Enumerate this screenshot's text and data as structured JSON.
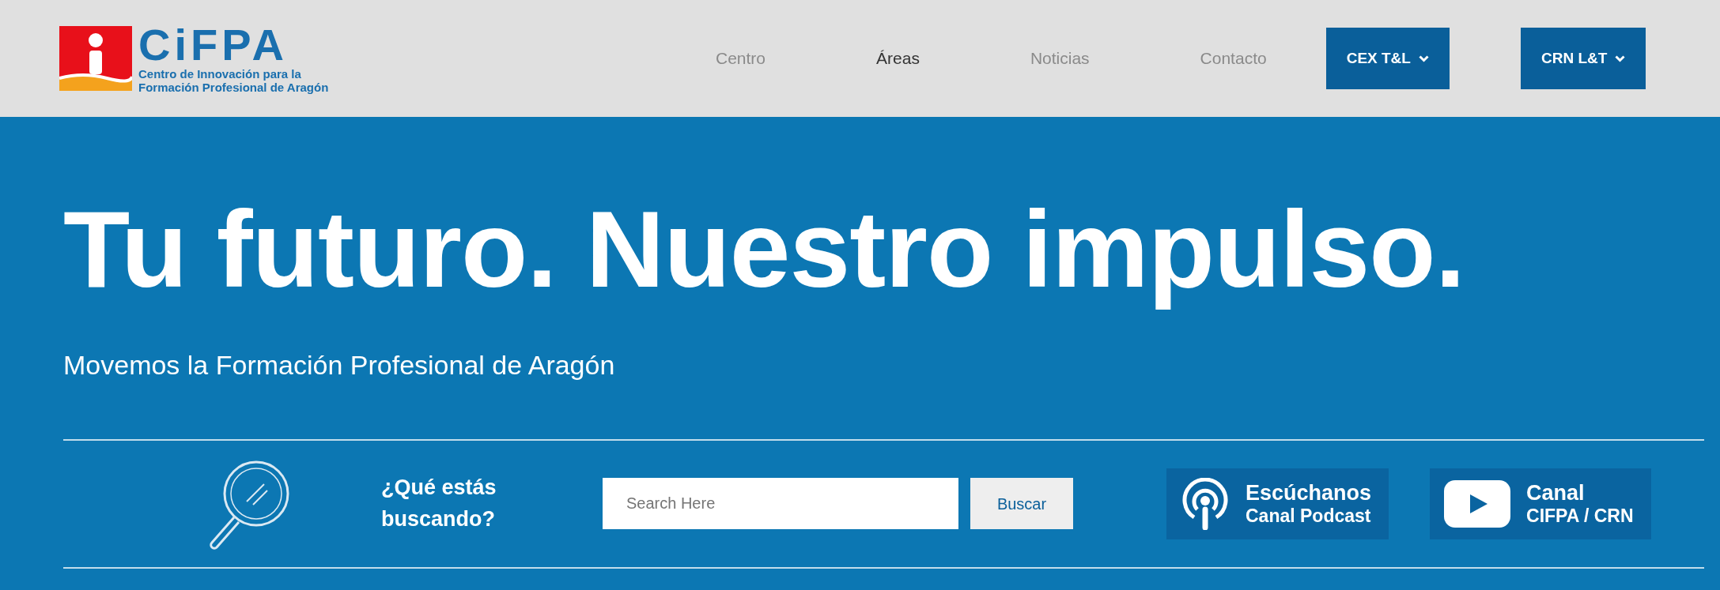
{
  "logo": {
    "name": "CiFPA",
    "subtitle_lines": [
      "Centro de Innovación para la",
      "Formación Profesional de Aragón"
    ]
  },
  "nav": [
    {
      "label": "Centro",
      "selected": false
    },
    {
      "label": "Áreas",
      "selected": true
    },
    {
      "label": "Noticias",
      "selected": false
    },
    {
      "label": "Contacto",
      "selected": false
    }
  ],
  "nav_buttons": [
    {
      "label": "CEX T&L"
    },
    {
      "label": "CRN L&T"
    }
  ],
  "hero": {
    "title": "Tu futuro. Nuestro impulso.",
    "subtitle": "Movemos la Formación Profesional de Aragón"
  },
  "search": {
    "prompt_lines": [
      "¿Qué estás",
      "buscando?"
    ],
    "placeholder": "Search Here",
    "button": "Buscar"
  },
  "channels": [
    {
      "kind": "podcast",
      "lines": [
        "Escúchanos",
        "Canal Podcast"
      ]
    },
    {
      "kind": "video",
      "lines": [
        "Canal",
        "CIFPA / CRN"
      ]
    }
  ]
}
